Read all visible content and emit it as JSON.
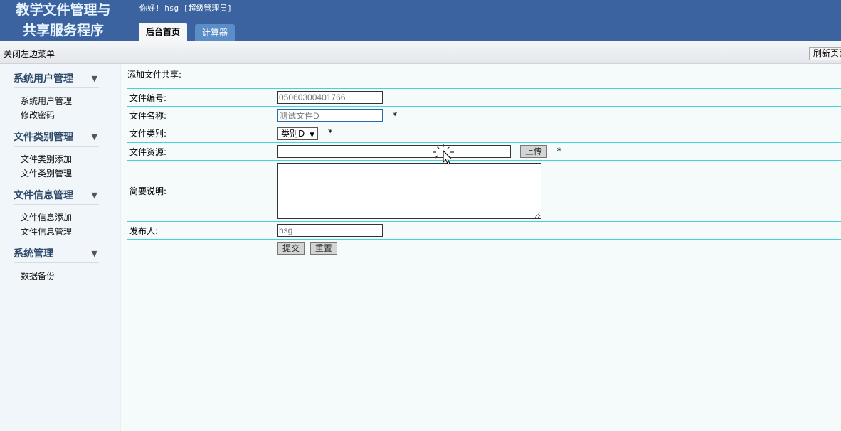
{
  "header": {
    "logo_line1": "教学文件管理与",
    "logo_line2": "共享服务程序",
    "greeting": "你好! hsg [超级管理员]",
    "tabs": [
      {
        "label": "后台首页",
        "active": true
      },
      {
        "label": "计算器",
        "active": false
      }
    ]
  },
  "toolbar": {
    "close_menu": "关闭左边菜单",
    "refresh": "刷新页面"
  },
  "sidebar": {
    "groups": [
      {
        "title": "系统用户管理",
        "items": [
          "系统用户管理",
          "修改密码"
        ]
      },
      {
        "title": "文件类别管理",
        "items": [
          "文件类别添加",
          "文件类别管理"
        ]
      },
      {
        "title": "文件信息管理",
        "items": [
          "文件信息添加",
          "文件信息管理"
        ]
      },
      {
        "title": "系统管理",
        "items": [
          "数据备份"
        ]
      }
    ]
  },
  "main": {
    "heading": "添加文件共享:",
    "form": {
      "file_no_label": "文件编号:",
      "file_no_value": "05060300401766",
      "file_name_label": "文件名称:",
      "file_name_value": "测试文件D",
      "file_type_label": "文件类别:",
      "file_type_value": "类别D",
      "file_resource_label": "文件资源:",
      "file_resource_value": "",
      "upload_label": "上传",
      "summary_label": "简要说明:",
      "summary_value": "",
      "publisher_label": "发布人:",
      "publisher_value": "hsg",
      "required_mark": "*",
      "submit_label": "提交",
      "reset_label": "重置"
    }
  },
  "colors": {
    "header_bg": "#3a63a0",
    "tab_inactive": "#5b8ec8",
    "table_border": "#48d1d6",
    "menu_title": "#2f4a6a"
  }
}
